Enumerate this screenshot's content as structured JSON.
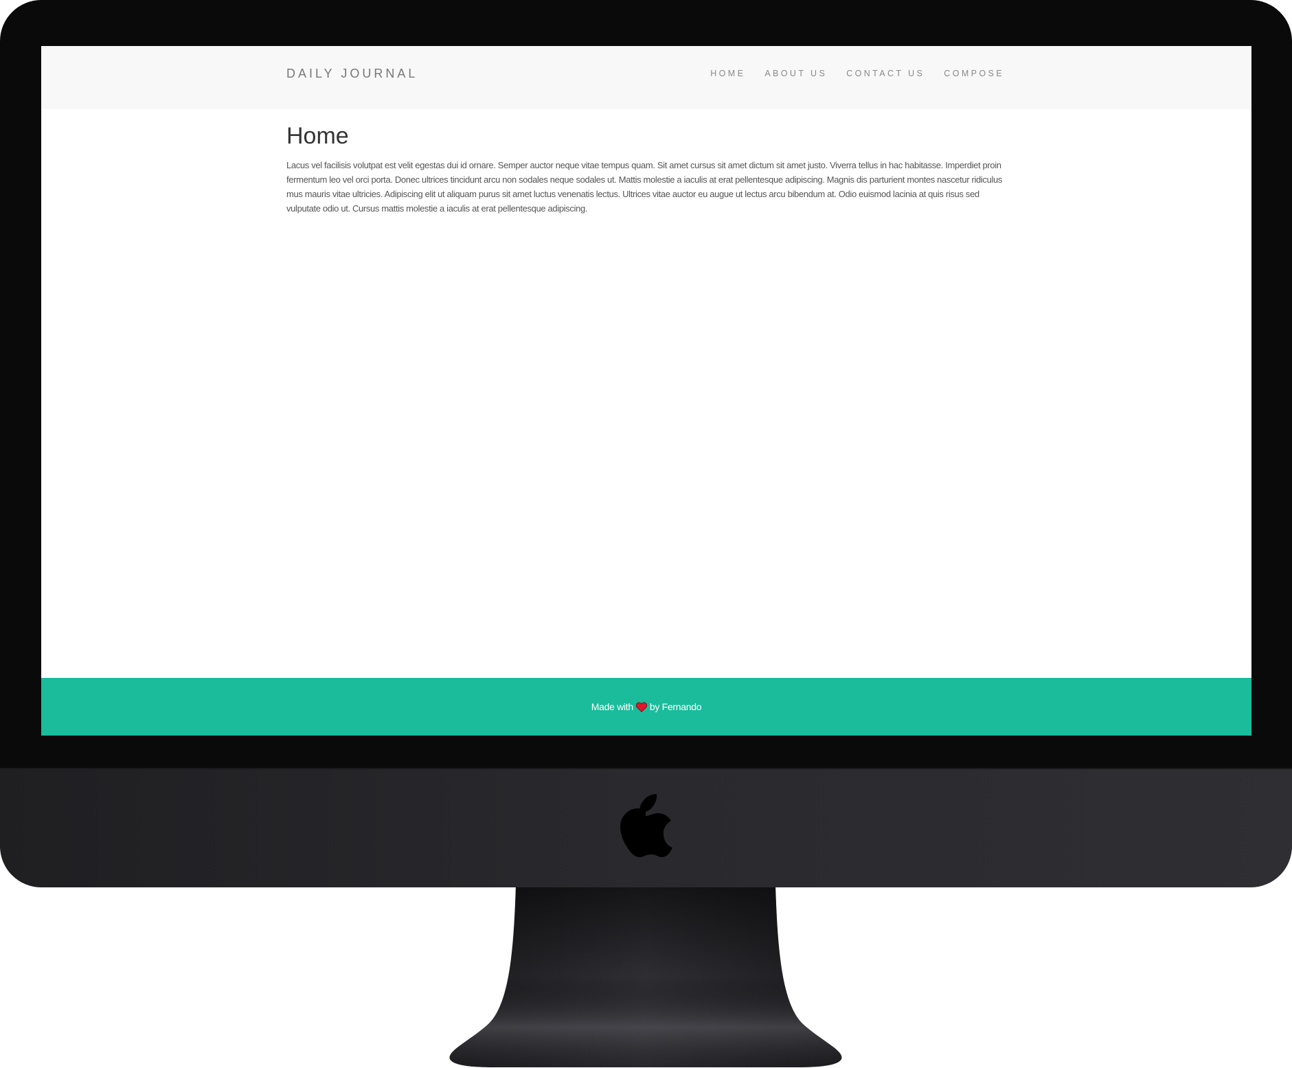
{
  "header": {
    "brand": "DAILY JOURNAL",
    "nav": [
      {
        "label": "HOME"
      },
      {
        "label": "ABOUT US"
      },
      {
        "label": "CONTACT US"
      },
      {
        "label": "COMPOSE"
      }
    ]
  },
  "main": {
    "title": "Home",
    "body": "Lacus vel facilisis volutpat est velit egestas dui id ornare. Semper auctor neque vitae tempus quam. Sit amet cursus sit amet dictum sit amet justo. Viverra tellus in hac habitasse. Imperdiet proin fermentum leo vel orci porta. Donec ultrices tincidunt arcu non sodales neque sodales ut. Mattis molestie a iaculis at erat pellentesque adipiscing. Magnis dis parturient montes nascetur ridiculus mus mauris vitae ultricies. Adipiscing elit ut aliquam purus sit amet luctus venenatis lectus. Ultrices vitae auctor eu augue ut lectus arcu bibendum at. Odio euismod lacinia at quis risus sed vulputate odio ut. Cursus mattis molestie a iaculis at erat pellentesque adipiscing."
  },
  "footer": {
    "prefix": "Made with",
    "icon": "heart-icon",
    "suffix": "by Fernando"
  },
  "colors": {
    "header_bg": "#f8f8f8",
    "footer_bg": "#1abc9c",
    "heart": "#e0162b",
    "bezel": "#0a0a0b"
  }
}
